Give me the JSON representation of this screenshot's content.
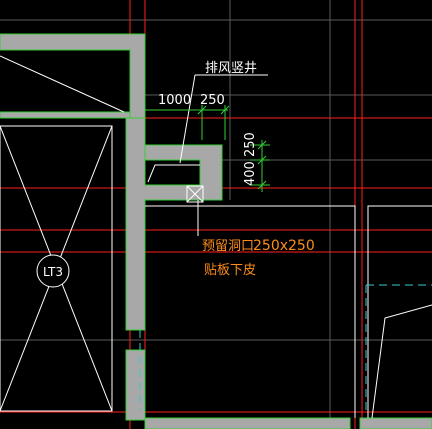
{
  "drawing": {
    "background_color": "#000000",
    "wall_fill_color": "#a8a8a8",
    "wall_outline_color": "#33cc33",
    "axis_color": "#ff2020",
    "grid_color": "#5a5a5a",
    "dim_color": "#33cc33",
    "elevator_line_color": "#ffffff",
    "dashed_line_color": "#33cccc",
    "annotation_color": "#ff8c1a"
  },
  "labels": {
    "shaft_label": "排风竖井",
    "dim_horizontal_1": "1000",
    "dim_horizontal_2": "250",
    "dim_vertical_1": "250",
    "dim_vertical_2": "400",
    "elevator_tag": "LT3",
    "opening_title": "预留洞口",
    "opening_size": "250x250",
    "opening_note": "贴板下皮"
  }
}
